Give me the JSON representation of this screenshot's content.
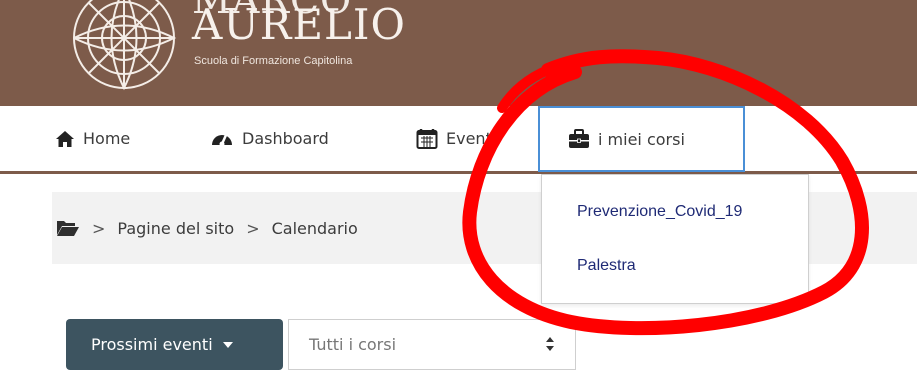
{
  "header": {
    "logo_line1": "MARCO",
    "logo_line2": "AURELIO",
    "logo_subtitle": "Scuola di Formazione Capitolina"
  },
  "nav": {
    "home": "Home",
    "dashboard": "Dashboard",
    "events": "Eventi",
    "my_courses": "i miei corsi"
  },
  "breadcrumb": {
    "icon": "folder-open-icon",
    "items": [
      "Pagine del sito",
      "Calendario"
    ],
    "separator": ">"
  },
  "dropdown": {
    "items": [
      "Prevenzione_Covid_19",
      "Palestra"
    ]
  },
  "controls": {
    "events_button": "Prossimi eventi",
    "course_select": "Tutti i corsi"
  },
  "colors": {
    "banner": "#7d5b4a",
    "button": "#3d5460",
    "link": "#1f2a75",
    "focus_border": "#4a8fd6",
    "annotation": "#ff0000"
  }
}
